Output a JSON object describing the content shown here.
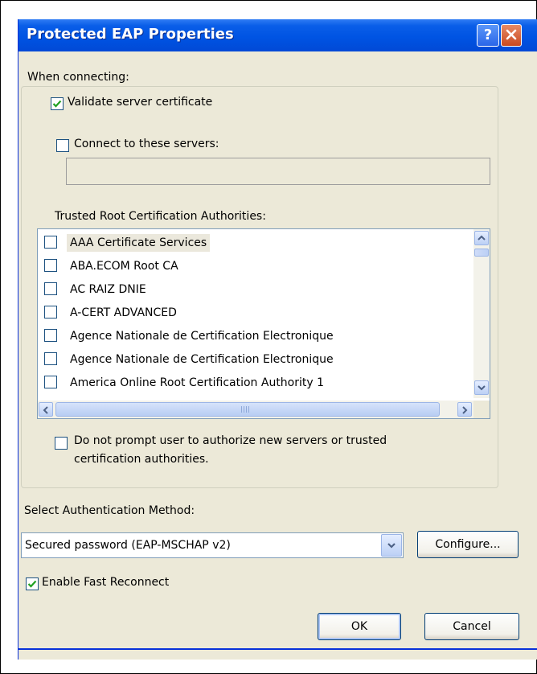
{
  "window": {
    "title": "Protected EAP Properties"
  },
  "labels": {
    "when_connecting": "When connecting:",
    "validate_server_certificate": "Validate server certificate",
    "connect_to_servers": "Connect to these servers:",
    "trusted_root_ca": "Trusted Root Certification Authorities:",
    "no_prompt_line1": "Do not prompt user to authorize new servers or trusted",
    "no_prompt_line2": "certification authorities.",
    "select_auth_method": "Select Authentication Method:",
    "enable_fast_reconnect": "Enable Fast Reconnect"
  },
  "checkboxes": {
    "validate_server_certificate": true,
    "connect_to_servers": false,
    "no_prompt": false,
    "enable_fast_reconnect": true
  },
  "inputs": {
    "servers_value": ""
  },
  "ca_list": [
    {
      "label": "AAA Certificate Services",
      "checked": false,
      "selected": true
    },
    {
      "label": "ABA.ECOM Root CA",
      "checked": false,
      "selected": false
    },
    {
      "label": "AC RAIZ DNIE",
      "checked": false,
      "selected": false
    },
    {
      "label": "A-CERT ADVANCED",
      "checked": false,
      "selected": false
    },
    {
      "label": "Agence Nationale de Certification Electronique",
      "checked": false,
      "selected": false
    },
    {
      "label": "Agence Nationale de Certification Electronique",
      "checked": false,
      "selected": false
    },
    {
      "label": "America Online Root Certification Authority 1",
      "checked": false,
      "selected": false
    }
  ],
  "auth_method": {
    "selected": "Secured password (EAP-MSCHAP v2)"
  },
  "buttons": {
    "configure": "Configure...",
    "ok": "OK",
    "cancel": "Cancel",
    "help": "?"
  },
  "colors": {
    "titlebar": "#0054e3",
    "dialog_bg": "#ece9d8",
    "check": "#21a121"
  }
}
